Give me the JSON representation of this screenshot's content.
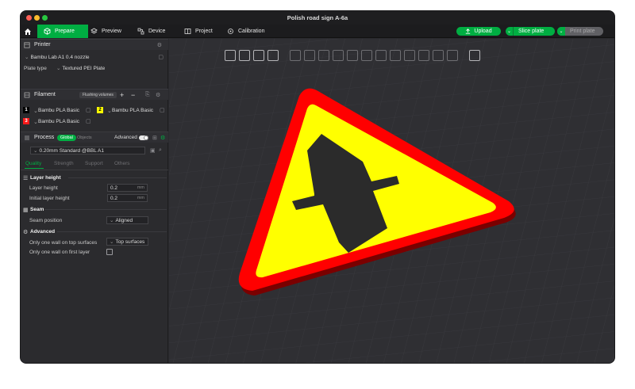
{
  "window": {
    "title": "Polish road sign A-6a"
  },
  "menu": {
    "tabs": [
      {
        "label": "Prepare",
        "icon": "cube-icon"
      },
      {
        "label": "Preview",
        "icon": "layers-icon"
      },
      {
        "label": "Device",
        "icon": "device-icon"
      },
      {
        "label": "Project",
        "icon": "project-icon"
      },
      {
        "label": "Calibration",
        "icon": "calibration-icon"
      }
    ],
    "upload_label": "Upload",
    "slice_label": "Slice plate",
    "print_label": "Print plate"
  },
  "printer": {
    "header": "Printer",
    "name": "Bambu Lab A1 0.4 nozzle",
    "plate_type_label": "Plate type",
    "plate_type_value": "Textured PEI Plate"
  },
  "filament": {
    "header": "Filament",
    "flushing_label": "Flushing volumes",
    "items": [
      {
        "num": "1",
        "name": "Bambu PLA Basic",
        "color": "#000000",
        "text_color": "#ffffff"
      },
      {
        "num": "2",
        "name": "Bambu PLA Basic",
        "color": "#ffff00",
        "text_color": "#000000"
      },
      {
        "num": "3",
        "name": "Bambu PLA Basic",
        "color": "#ff1a1a",
        "text_color": "#ffffff"
      }
    ]
  },
  "process": {
    "header": "Process",
    "global_label": "Global",
    "objects_label": "Objects",
    "advanced_label": "Advanced",
    "preset": "0.20mm Standard @BBL A1",
    "tabs": [
      "Quality",
      "Strength",
      "Support",
      "Others"
    ],
    "groups": {
      "layer_height": "Layer height",
      "seam": "Seam",
      "advanced": "Advanced"
    },
    "params": {
      "layer_height_label": "Layer height",
      "layer_height_value": "0.2",
      "initial_layer_height_label": "Initial layer height",
      "initial_layer_height_value": "0.2",
      "unit": "mm",
      "seam_position_label": "Seam position",
      "seam_position_value": "Aligned",
      "one_wall_top_label": "Only one wall on top surfaces",
      "one_wall_top_value": "Top surfaces",
      "one_wall_first_label": "Only one wall on first layer"
    }
  },
  "colors": {
    "accent": "#00ae42",
    "sign_red": "#ff0000",
    "sign_yellow": "#ffff00",
    "symbol": "#2b2b2b"
  }
}
